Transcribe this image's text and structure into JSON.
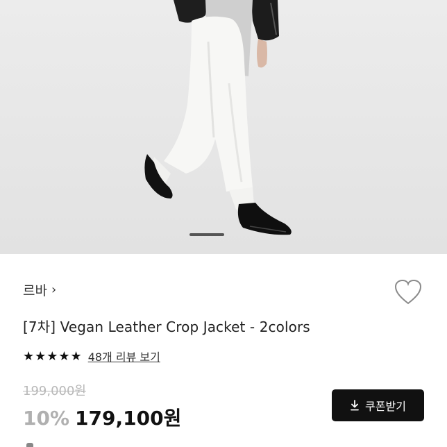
{
  "carousel": {
    "current": 1
  },
  "product": {
    "brand": "르바",
    "brand_chevron": "›",
    "title": "[7차] Vegan Leather Crop Jacket - 2colors",
    "rating_stars": "★★★★★",
    "rating": 5,
    "review_link": "48개 리뷰 보기",
    "original_price": "199,000원",
    "discount": "10%",
    "final_price": "179,100원"
  },
  "actions": {
    "coupon_label": "쿠폰받기",
    "coupon_icon": "download-icon",
    "wishlist_icon": "heart-icon"
  },
  "colors": {
    "accent": "#111111",
    "muted": "#b0b0b0"
  }
}
